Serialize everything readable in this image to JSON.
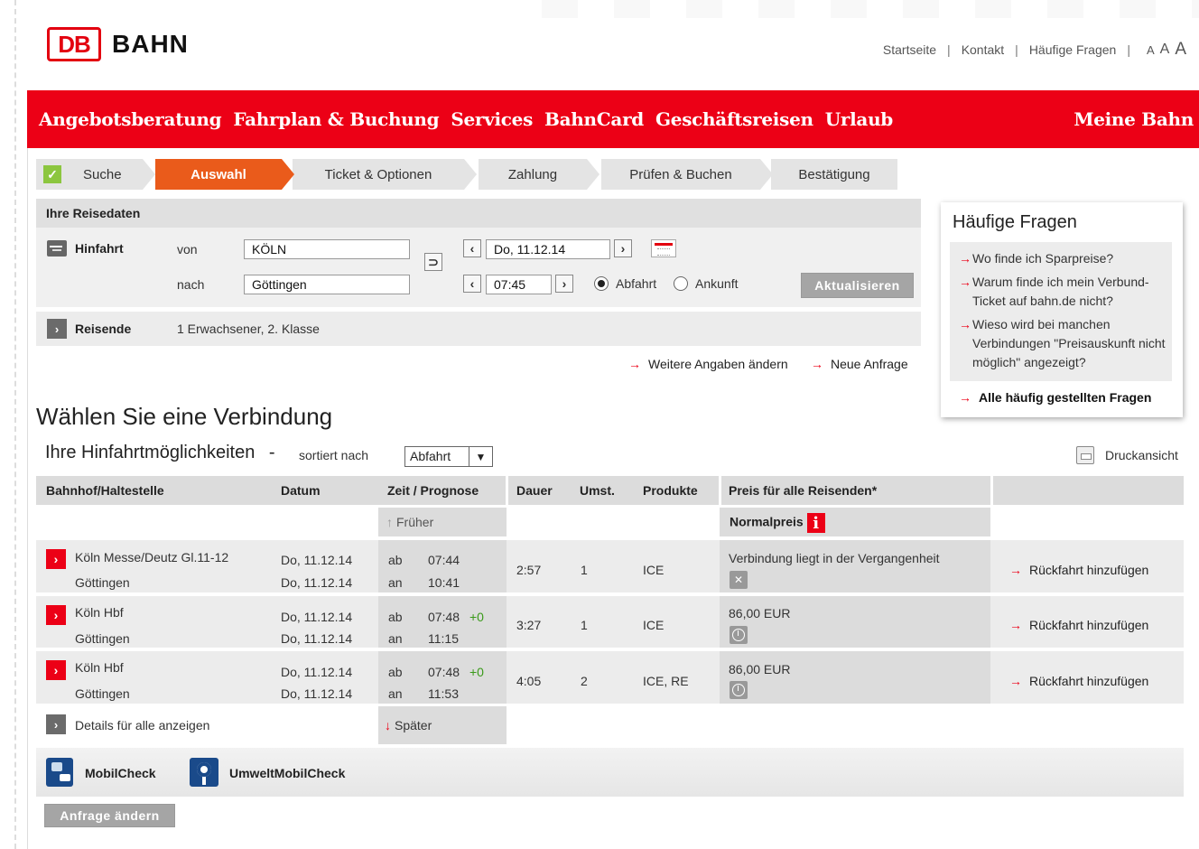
{
  "brand": {
    "logo_mark": "DB",
    "logo_text": "BAHN",
    "accent": "#ec0016"
  },
  "topnav": {
    "startseite": "Startseite",
    "kontakt": "Kontakt",
    "faq": "Häufige Fragen",
    "font_small": "A",
    "font_medium": "A",
    "font_large": "A"
  },
  "mainnav": [
    "Angebotsberatung",
    "Fahrplan & Buchung",
    "Services",
    "BahnCard",
    "Geschäftsreisen",
    "Urlaub"
  ],
  "mainnav_right": "Meine Bahn",
  "steps": [
    "Suche",
    "Auswahl",
    "Ticket & Optionen",
    "Zahlung",
    "Prüfen & Buchen",
    "Bestätigung"
  ],
  "reisedaten": {
    "title": "Ihre Reisedaten",
    "hinfahrt": "Hinfahrt",
    "von_label": "von",
    "nach_label": "nach",
    "von_value": "KÖLN",
    "nach_value": "Göttingen",
    "date_value": "Do, 11.12.14",
    "time_value": "07:45",
    "abfahrt": "Abfahrt",
    "ankunft": "Ankunft",
    "update_button": "Aktualisieren",
    "reisende_label": "Reisende",
    "reisende_value": "1 Erwachsener, 2. Klasse",
    "weitere": "Weitere Angaben ändern",
    "neue": "Neue Anfrage"
  },
  "faq_box": {
    "title": "Häufige Fragen",
    "items": [
      "Wo finde ich Sparpreise?",
      "Warum finde ich mein Verbund-Ticket auf bahn.de nicht?",
      "Wieso wird bei manchen Verbindungen \"Preisauskunft nicht möglich\" angezeigt?"
    ],
    "all": "Alle häufig gestellten Fragen"
  },
  "results": {
    "heading": "Wählen Sie eine Verbindung",
    "subheading": "Ihre Hinfahrtmöglichkeiten",
    "dash": "-",
    "sort_label": "sortiert nach",
    "sort_value": "Abfahrt",
    "print": "Druckansicht",
    "headers": {
      "station": "Bahnhof/Haltestelle",
      "date": "Datum",
      "time": "Zeit / Prognose",
      "duration": "Dauer",
      "changes": "Umst.",
      "products": "Produkte",
      "price": "Preis für alle Reisenden*"
    },
    "earlier": "Früher",
    "later": "Später",
    "normalpreis": "Normalpreis",
    "rows": [
      {
        "from": "Köln Messe/Deutz Gl.11-12",
        "to": "Göttingen",
        "date_from": "Do, 11.12.14",
        "date_to": "Do, 11.12.14",
        "ab": "ab",
        "an": "an",
        "dep": "07:44",
        "arr": "10:41",
        "delay": "",
        "duration": "2:57",
        "changes": "1",
        "products": "ICE",
        "price": "Verbindung liegt in der Vergangenheit",
        "return": "Rückfahrt hinzufügen"
      },
      {
        "from": "Köln Hbf",
        "to": "Göttingen",
        "date_from": "Do, 11.12.14",
        "date_to": "Do, 11.12.14",
        "ab": "ab",
        "an": "an",
        "dep": "07:48",
        "arr": "11:15",
        "delay": "+0",
        "duration": "3:27",
        "changes": "1",
        "products": "ICE",
        "price": "86,00 EUR",
        "return": "Rückfahrt hinzufügen"
      },
      {
        "from": "Köln Hbf",
        "to": "Göttingen",
        "date_from": "Do, 11.12.14",
        "date_to": "Do, 11.12.14",
        "ab": "ab",
        "an": "an",
        "dep": "07:48",
        "arr": "11:53",
        "delay": "+0",
        "duration": "4:05",
        "changes": "2",
        "products": "ICE, RE",
        "price": "86,00 EUR",
        "return": "Rückfahrt hinzufügen"
      }
    ],
    "details_all": "Details für alle anzeigen"
  },
  "bottom": {
    "mobilcheck": "MobilCheck",
    "umwelt": "UmweltMobilCheck",
    "change_request": "Anfrage ändern"
  }
}
